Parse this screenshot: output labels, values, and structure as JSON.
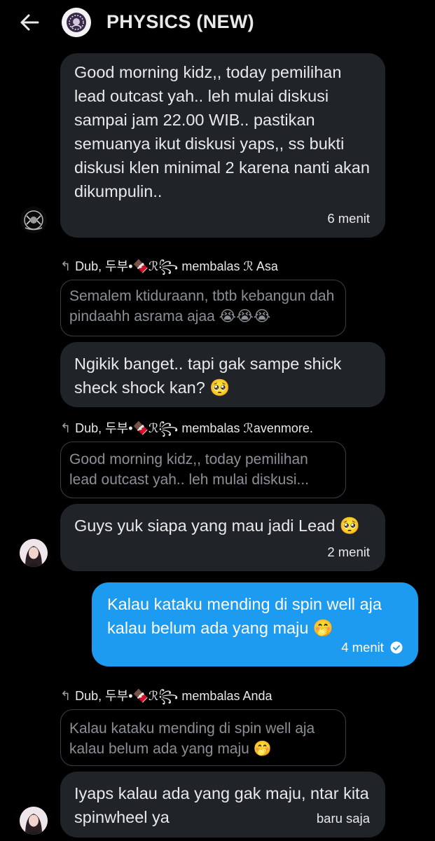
{
  "header": {
    "title": "PHYSICS (NEW)",
    "back_icon": "arrow-left-icon",
    "avatar_icon": "group-avatar-icon"
  },
  "messages": [
    {
      "text": "Good morning kidz,, today pemilihan lead outcast yah.. leh mulai diskusi sampai jam 22.00 WIB.. pastikan semuanya ikut diskusi yaps,, ss bukti diskusi klen minimal 2 karena nanti akan dikumpulin..",
      "time": "6 menit"
    },
    {
      "reply_meta": "Dub, 두부•🍫ℛ꧂ membalas ℛ Asa",
      "quote": "Semalem ktiduraann, tbtb kebangun dah pindaahh asrama ajaa 😭😭😭",
      "text": "Ngikik banget.. tapi gak sampe shick sheck shock kan? 🥺"
    },
    {
      "reply_meta": "Dub, 두부•🍫ℛ꧂ membalas ℛavenmore.",
      "quote": "Good morning kidz,, today pemilihan lead outcast yah.. leh mulai diskusi...",
      "text": "Guys yuk siapa yang mau jadi Lead 🥺",
      "time": "2 menit"
    },
    {
      "text": "Kalau kataku mending di spin well aja kalau belum ada yang maju 🤭",
      "time": "4 menit",
      "status_icon": "read-check-icon"
    },
    {
      "reply_meta": "Dub, 두부•🍫ℛ꧂ membalas Anda",
      "quote": "Kalau kataku mending di spin well aja kalau belum ada yang maju 🤭",
      "text": "Iyaps kalau ada yang gak maju, ntar kita spinwheel ya",
      "time": "baru saja"
    }
  ],
  "colors": {
    "background": "#000000",
    "incoming_bubble": "#202327",
    "outgoing_bubble": "#1d9bf0",
    "quote_border": "#3b3f45",
    "quote_text": "#8b9096"
  }
}
